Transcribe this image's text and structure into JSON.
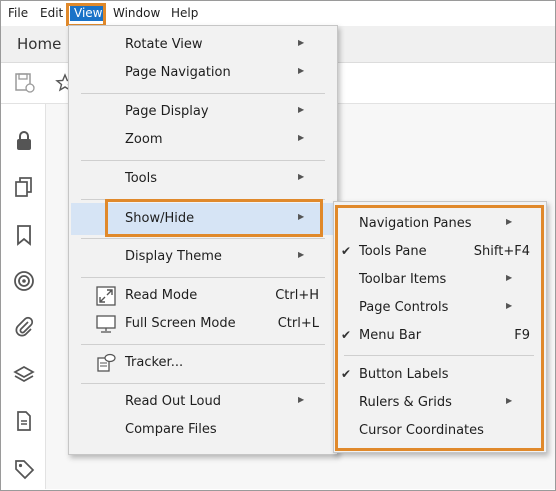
{
  "menubar": {
    "items": [
      {
        "label": "File"
      },
      {
        "label": "Edit"
      },
      {
        "label": "View"
      },
      {
        "label": "Window"
      },
      {
        "label": "Help"
      }
    ]
  },
  "home_tab": "Home",
  "view_menu": {
    "items": [
      {
        "label": "Rotate View"
      },
      {
        "label": "Page Navigation"
      },
      {
        "label": "Page Display"
      },
      {
        "label": "Zoom"
      },
      {
        "label": "Tools"
      },
      {
        "label": "Show/Hide"
      },
      {
        "label": "Display Theme"
      },
      {
        "label": "Read Mode",
        "shortcut": "Ctrl+H"
      },
      {
        "label": "Full Screen Mode",
        "shortcut": "Ctrl+L"
      },
      {
        "label": "Tracker..."
      },
      {
        "label": "Read Out Loud"
      },
      {
        "label": "Compare Files"
      }
    ]
  },
  "showhide_menu": {
    "items": [
      {
        "label": "Navigation Panes"
      },
      {
        "label": "Tools Pane",
        "shortcut": "Shift+F4"
      },
      {
        "label": "Toolbar Items"
      },
      {
        "label": "Page Controls"
      },
      {
        "label": "Menu Bar",
        "shortcut": "F9"
      },
      {
        "label": "Button Labels"
      },
      {
        "label": "Rulers & Grids"
      },
      {
        "label": "Cursor Coordinates"
      }
    ]
  },
  "colors": {
    "highlight_border": "#e0892b",
    "menu_active": "#1a73c8",
    "hover_row": "#d6e4f5"
  }
}
